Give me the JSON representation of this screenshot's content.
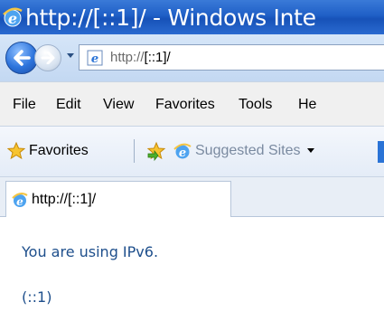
{
  "window": {
    "title": "http://[::1]/ - Windows Inte"
  },
  "navigation": {
    "address_prefix": "http://",
    "address_host": "[::1]/"
  },
  "menu": {
    "items": [
      "File",
      "Edit",
      "View",
      "Favorites",
      "Tools",
      "He"
    ]
  },
  "favorites_bar": {
    "favorites_label": "Favorites",
    "suggested_sites_label": "Suggested Sites"
  },
  "tab": {
    "label": "http://[::1]/"
  },
  "content": {
    "message": "You are using IPv6.",
    "address": "(::1)"
  },
  "colors": {
    "title_bar": "#1f5fc6",
    "content_text": "#1e4f8c"
  }
}
